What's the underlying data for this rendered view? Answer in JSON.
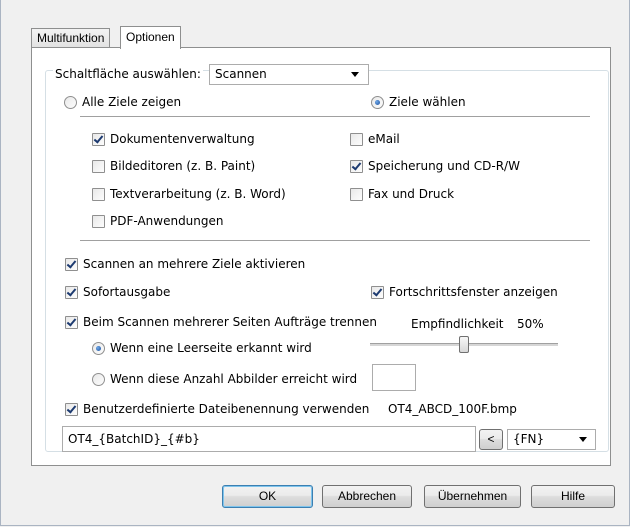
{
  "tabs": [
    {
      "label": "Multifunktion"
    },
    {
      "label": "Optionen"
    }
  ],
  "button_select": {
    "label": "Schaltfläche auswählen:",
    "value": "Scannen"
  },
  "targets": {
    "show_all_label": "Alle Ziele zeigen",
    "choose_label": "Ziele wählen",
    "selected": "Ziele wählen",
    "items": [
      {
        "label": "Dokumentenverwaltung",
        "checked": true
      },
      {
        "label": "Bildeditoren (z. B. Paint)",
        "checked": false
      },
      {
        "label": "Textverarbeitung (z. B. Word)",
        "checked": false
      },
      {
        "label": "PDF-Anwendungen",
        "checked": false
      },
      {
        "label": "eMail",
        "checked": false
      },
      {
        "label": "Speicherung und CD-R/W",
        "checked": true
      },
      {
        "label": "Fax und Druck",
        "checked": false
      }
    ]
  },
  "options": {
    "multi_target": {
      "label": "Scannen an mehrere Ziele aktivieren",
      "checked": true
    },
    "instant_output": {
      "label": "Sofortausgabe",
      "checked": true
    },
    "progress_window": {
      "label": "Fortschrittsfenster anzeigen",
      "checked": true
    },
    "split_jobs": {
      "label": "Beim Scannen mehrerer Seiten Aufträge trennen",
      "checked": true
    },
    "sensitivity_label": "Empfindlichkeit",
    "sensitivity_value": "50%",
    "sensitivity_level": 0.5,
    "blank_page": {
      "label": "Wenn eine Leerseite erkannt wird",
      "selected": true
    },
    "page_count": {
      "label": "Wenn diese Anzahl Abbilder erreicht wird",
      "selected": false,
      "value": ""
    },
    "custom_filename": {
      "label": "Benutzerdefinierte Dateibenennung verwenden",
      "checked": true,
      "example": "OT4_ABCD_100F.bmp"
    },
    "filename_pattern": "OT4_{BatchID}_{#b}",
    "insert_button": "<",
    "token_select": "{FN}"
  },
  "footer": {
    "ok": "OK",
    "cancel": "Abbrechen",
    "apply": "Übernehmen",
    "help": "Hilfe"
  }
}
